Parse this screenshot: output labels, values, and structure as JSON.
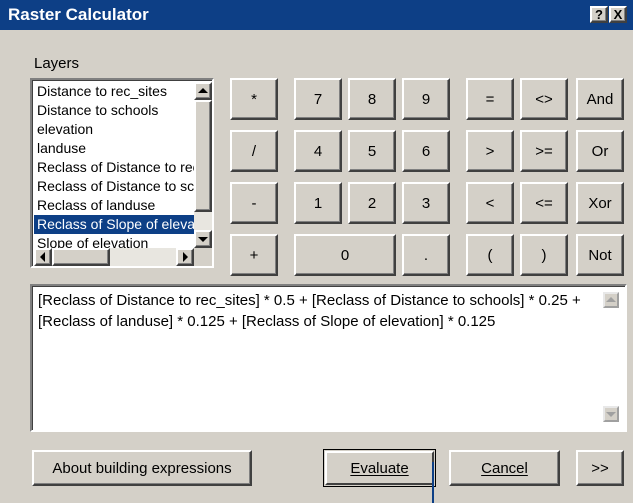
{
  "window": {
    "title": "Raster Calculator",
    "help_glyph": "?",
    "close_glyph": "X",
    "title_bg": "#0d3f86",
    "face_color": "#d4d0c8"
  },
  "layers": {
    "label": "Layers",
    "items": [
      "Distance to rec_sites",
      "Distance to schools",
      "elevation",
      "landuse",
      "Reclass of Distance to rec_sites",
      "Reclass of Distance to schools",
      "Reclass of landuse",
      "Reclass of Slope of elevation",
      "Slope of elevation"
    ],
    "selected_index": 7
  },
  "keypad": {
    "operators": [
      "*",
      "/",
      "-",
      "+"
    ],
    "digits_row1": [
      "7",
      "8",
      "9"
    ],
    "digits_row2": [
      "4",
      "5",
      "6"
    ],
    "digits_row3": [
      "1",
      "2",
      "3"
    ],
    "zero": "0",
    "dot": ".",
    "compare_col1": [
      "=",
      ">",
      "<",
      "("
    ],
    "compare_col2": [
      "<>",
      ">=",
      "<=",
      ")"
    ],
    "logic": [
      "And",
      "Or",
      "Xor",
      "Not"
    ]
  },
  "expression": {
    "text": "[Reclass of Distance to rec_sites] * 0.5 + [Reclass of Distance to schools]  * 0.25 + [Reclass of landuse] * 0.125 + [Reclass of Slope of elevation] * 0.125"
  },
  "buttons": {
    "about": "About building expressions",
    "evaluate": "Evaluate",
    "cancel": "Cancel",
    "expand": ">>"
  }
}
